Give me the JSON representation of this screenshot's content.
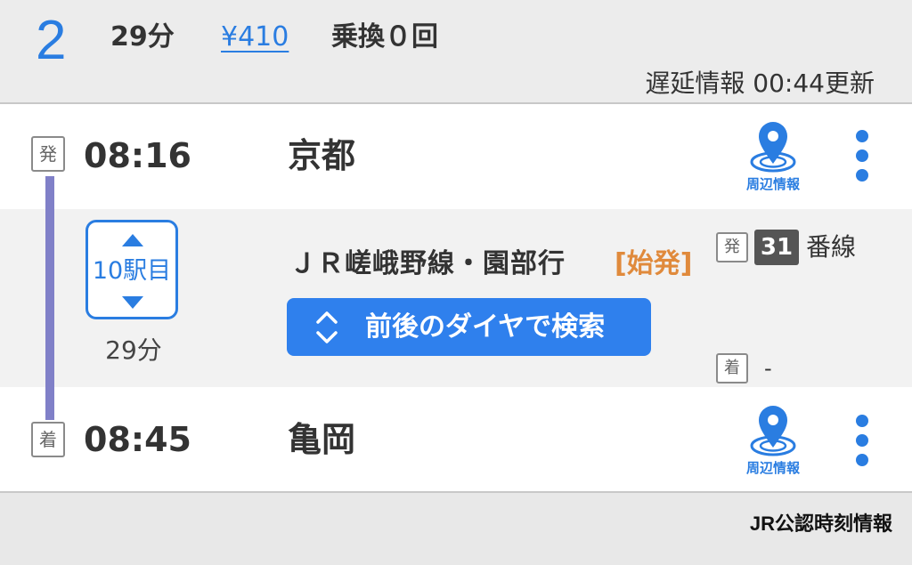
{
  "header": {
    "route_number": "2",
    "duration": "29分",
    "fare": "¥410",
    "transfers": "乗換０回",
    "delay_info": "遅延情報 00:44更新"
  },
  "departure": {
    "tag": "発",
    "time": "08:16",
    "station": "京都",
    "map_label": "周辺情報"
  },
  "segment": {
    "stations_count": "10駅目",
    "duration": "29分",
    "line_name": "ＪＲ嵯峨野線・園部行",
    "first_train": "[始発]",
    "search_button": "前後のダイヤで検索",
    "dep_tag": "発",
    "dep_platform": "31",
    "platform_suffix": "番線",
    "arr_tag": "着",
    "arr_platform": "-"
  },
  "arrival": {
    "tag": "着",
    "time": "08:45",
    "station": "亀岡",
    "map_label": "周辺情報"
  },
  "footer": {
    "brand": "JR公認時刻情報"
  },
  "icons": {
    "map": "map-pin-icon",
    "menu": "more-vertical-icon",
    "expand": "chevron-up-down-icon",
    "up": "triangle-up-icon",
    "down": "triangle-down-icon"
  },
  "colors": {
    "accent": "#2a7de1",
    "rail": "#8080c8",
    "first_train": "#e08a3c",
    "button": "#2f80ed"
  }
}
